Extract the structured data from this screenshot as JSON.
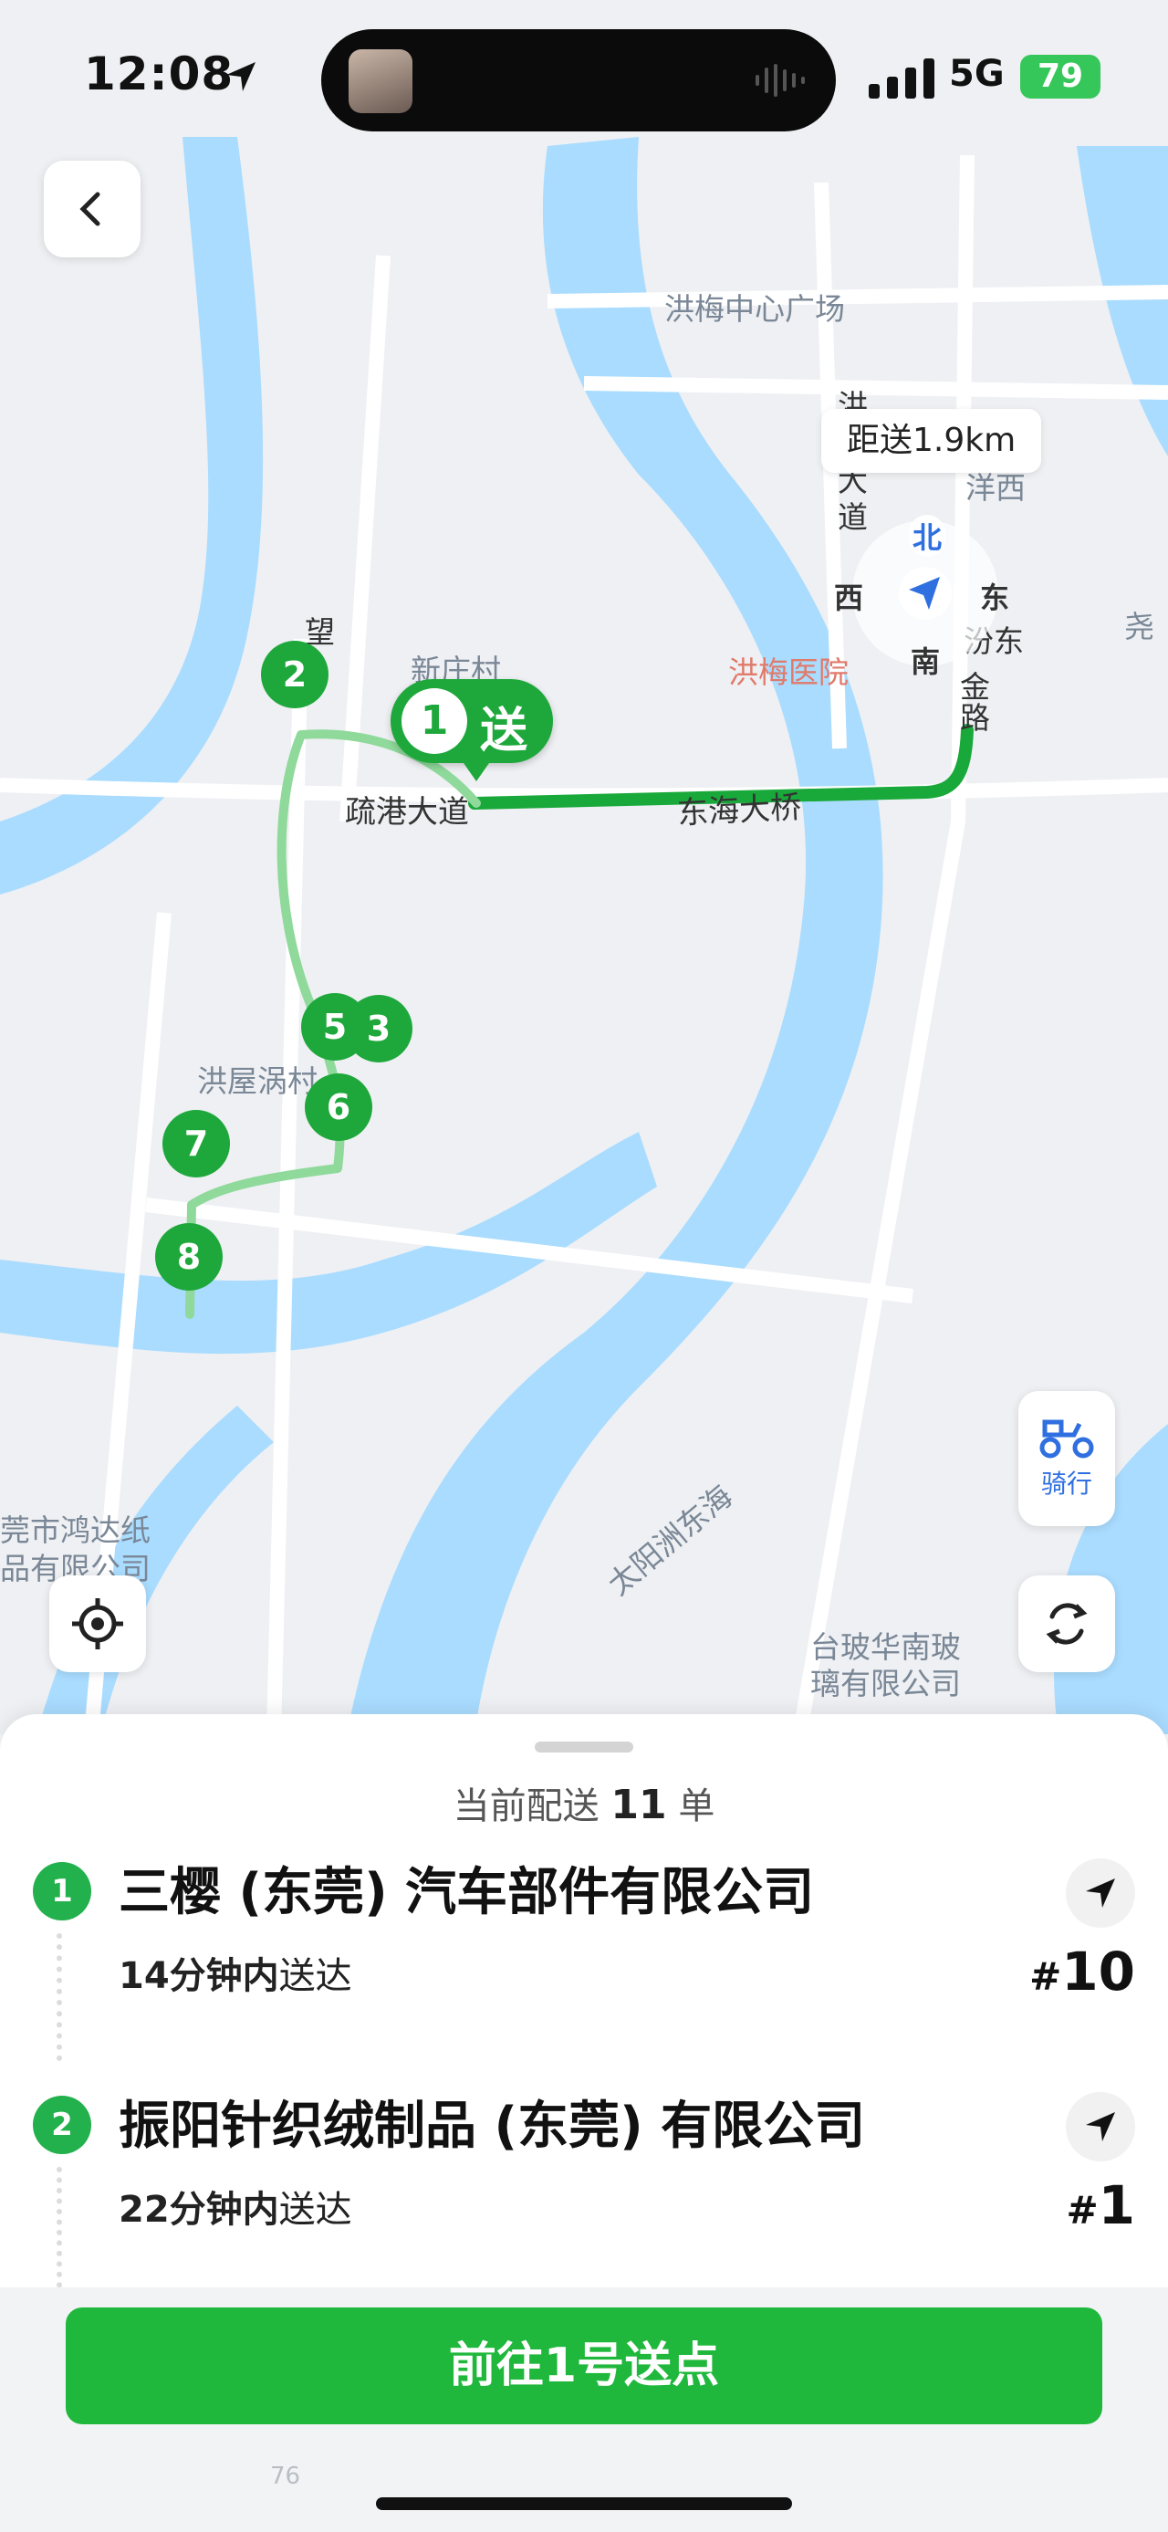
{
  "status_bar": {
    "time": "12:08",
    "network": "5G",
    "battery": "79"
  },
  "map": {
    "labels": {
      "hongmei_center": "洪梅中心广场",
      "xinzhuang": "新庄村",
      "hongmei_hospital": "洪梅医院",
      "shugang_road": "疏港大道",
      "donghai_bridge": "东海大桥",
      "hongwu": "洪屋涡村",
      "hongda": "莞市鸿达纸",
      "hongda2": "品有限公司",
      "taiyangzhou": "太阳洲东海",
      "taibohua": "台玻华南玻",
      "taibohua2": "璃有限公司",
      "hong_road_v": "洪",
      "da": "大",
      "dao": "道",
      "wang": "望",
      "yangxi": "洋西",
      "yao": "尧",
      "east_road": "汾东",
      "jin_road": "金",
      "lu": "路"
    },
    "distance_chip": "距送1.9km",
    "compass": {
      "north": "北",
      "south": "南",
      "west": "西",
      "east": "东"
    },
    "start_marker": {
      "number": "1",
      "label": "送"
    },
    "markers": [
      "2",
      "3",
      "5",
      "6",
      "7",
      "8"
    ],
    "ride_button": "骑行",
    "colors": {
      "route": "#19a83a",
      "water": "#a9dcff",
      "land": "#eef0f3",
      "road": "#ffffff"
    }
  },
  "sheet": {
    "title_prefix": "当前配送",
    "count": "11",
    "title_suffix": "单",
    "orders": [
      {
        "index": "1",
        "name": "三樱 (东莞) 汽车部件有限公司",
        "eta_num": "14",
        "eta_unit": "分钟内",
        "eta_text": "送达",
        "hash": "#",
        "number": "10"
      },
      {
        "index": "2",
        "name": "振阳针织绒制品 (东莞) 有限公司",
        "eta_num": "22",
        "eta_unit": "分钟内",
        "eta_text": "送达",
        "hash": "#",
        "number": "1"
      }
    ]
  },
  "footer": {
    "cta": "前往1号送点",
    "faint": "76"
  }
}
